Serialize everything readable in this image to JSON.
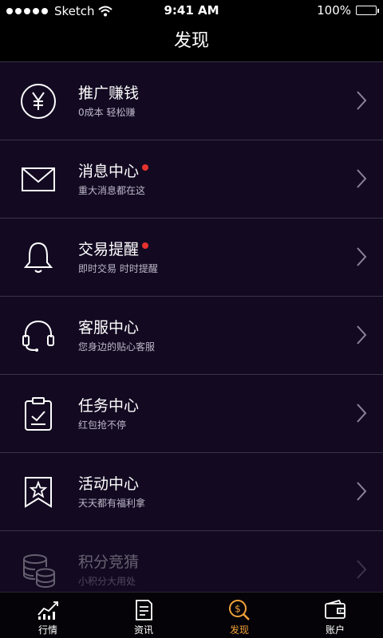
{
  "status": {
    "carrier": "Sketch",
    "time": "9:41 AM",
    "battery": "100%"
  },
  "nav": {
    "title": "发现"
  },
  "rows": [
    {
      "title": "推广赚钱",
      "subtitle": "0成本 轻松赚",
      "icon": "yen-circle-icon",
      "badge": false
    },
    {
      "title": "消息中心",
      "subtitle": "重大消息都在这",
      "icon": "envelope-icon",
      "badge": true
    },
    {
      "title": "交易提醒",
      "subtitle": "即时交易 时时提醒",
      "icon": "bell-icon",
      "badge": true
    },
    {
      "title": "客服中心",
      "subtitle": "您身边的贴心客服",
      "icon": "headset-icon",
      "badge": false
    },
    {
      "title": "任务中心",
      "subtitle": "红包抢不停",
      "icon": "clipboard-check-icon",
      "badge": false
    },
    {
      "title": "活动中心",
      "subtitle": "天天都有福利拿",
      "icon": "star-bookmark-icon",
      "badge": false
    },
    {
      "title": "积分竞猜",
      "subtitle": "小积分大用处",
      "icon": "coin-stack-icon",
      "badge": false
    }
  ],
  "tabs": [
    {
      "label": "行情",
      "icon": "chart-icon",
      "active": false
    },
    {
      "label": "资讯",
      "icon": "document-icon",
      "active": false
    },
    {
      "label": "发现",
      "icon": "dollar-search-icon",
      "active": true
    },
    {
      "label": "账户",
      "icon": "wallet-icon",
      "active": false
    }
  ],
  "colors": {
    "background": "#130a22",
    "header": "#000000",
    "badge": "#e6322e",
    "active_tab": "#f1a23a"
  }
}
